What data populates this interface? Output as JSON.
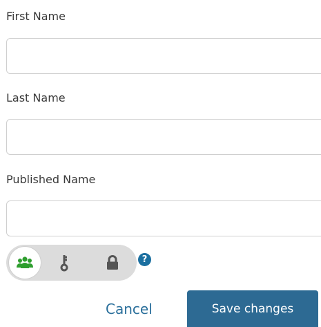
{
  "form": {
    "first_name": {
      "label": "First Name",
      "value": "",
      "placeholder": ""
    },
    "last_name": {
      "label": "Last Name",
      "value": "",
      "placeholder": ""
    },
    "published_name": {
      "label": "Published Name",
      "value": "",
      "placeholder": ""
    }
  },
  "visibility": {
    "options": [
      {
        "icon": "group-icon",
        "selected": true,
        "color": "#2e9e2e"
      },
      {
        "icon": "key-icon",
        "selected": false,
        "color": "#555555"
      },
      {
        "icon": "lock-icon",
        "selected": false,
        "color": "#555555"
      }
    ],
    "help_glyph": "?",
    "help_icon": "question-circle-icon"
  },
  "actions": {
    "cancel_label": "Cancel",
    "save_label": "Save changes"
  },
  "colors": {
    "accent": "#2d6a93",
    "link": "#2a6f9b",
    "selected_icon": "#2e9e2e",
    "toggle_bg": "#dcdcdc"
  }
}
